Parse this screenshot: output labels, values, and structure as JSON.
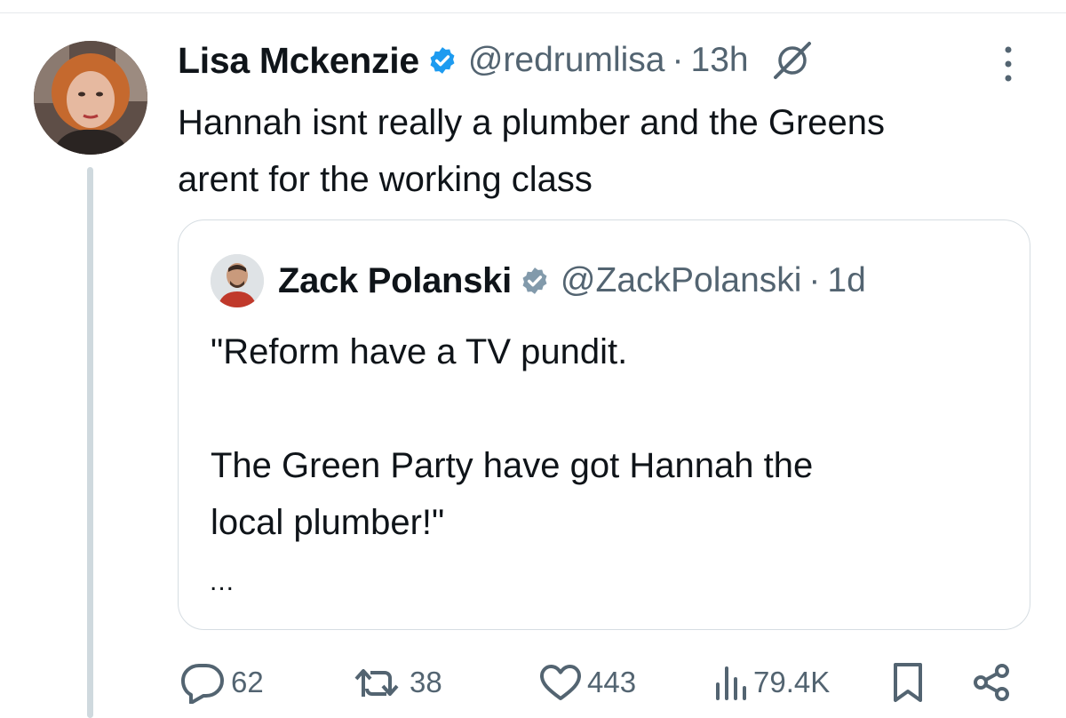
{
  "tweet": {
    "author_name": "Lisa Mckenzie",
    "handle": "@redrumlisa",
    "separator": "·",
    "time": "13h",
    "text": "Hannah isnt really a plumber and the Greens\narent for the working class"
  },
  "quoted_tweet": {
    "author_name": "Zack Polanski",
    "handle": "@ZackPolanski",
    "separator": "·",
    "time": "1d",
    "text": "\"Reform have a TV pundit.\n\nThe Green Party have got Hannah the\nlocal plumber!\"",
    "truncation": "..."
  },
  "actions": {
    "replies": "62",
    "retweets": "38",
    "likes": "443",
    "views": "79.4K"
  },
  "icons": {
    "verified": "verified-badge-icon",
    "quoted_verified": "gray-verified-badge-icon",
    "grok": "grok-icon",
    "more": "more-vertical-icon",
    "reply": "reply-icon",
    "retweet": "retweet-icon",
    "like": "heart-icon",
    "views": "views-icon",
    "bookmark": "bookmark-icon",
    "share": "share-icon"
  },
  "colors": {
    "verified_blue": "#1d9bf0",
    "gray_badge": "#829aab",
    "secondary_text": "#536471",
    "border": "#d6dde2"
  }
}
